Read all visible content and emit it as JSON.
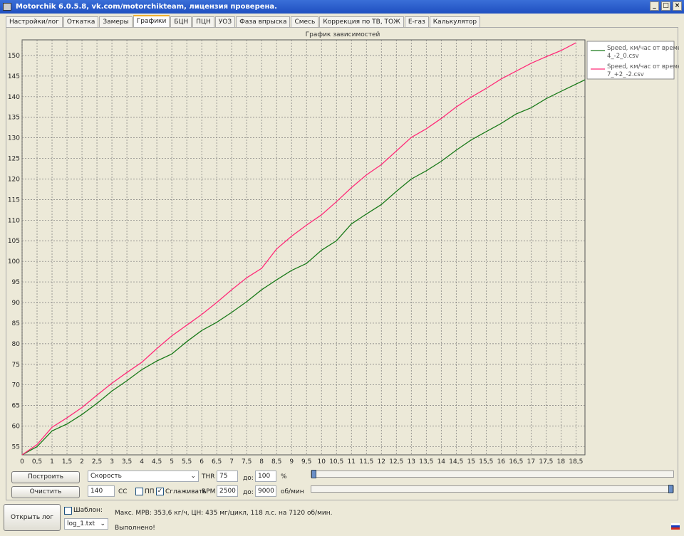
{
  "window": {
    "title": "Motorchik 6.0.5.8, vk.com/motorchikteam, лицензия проверена.",
    "buttons": [
      "_",
      "□",
      "×"
    ]
  },
  "tabs": [
    {
      "label": "Настройки/лог"
    },
    {
      "label": "Откатка"
    },
    {
      "label": "Замеры"
    },
    {
      "label": "Графики",
      "active": true
    },
    {
      "label": "БЦН"
    },
    {
      "label": "ПЦН"
    },
    {
      "label": "УОЗ"
    },
    {
      "label": "Фаза впрыска"
    },
    {
      "label": "Смесь"
    },
    {
      "label": "Коррекция по ТВ, ТОЖ"
    },
    {
      "label": "Е-газ"
    },
    {
      "label": "Калькулятор"
    }
  ],
  "controls": {
    "build": "Построить",
    "clear": "Очистить",
    "param": "Скорость",
    "cc_value": "140",
    "cc_label": "CC",
    "pp_label": "ПП",
    "smooth_label": "Сглаживать",
    "thr_label": "THR",
    "thr_from": "75",
    "to1": "до:",
    "thr_to": "100",
    "pct": "%",
    "rpm_label": "RPM",
    "rpm_from": "2500",
    "to2": "до:",
    "rpm_to": "9000",
    "rpm_unit": "об/мин",
    "slider1": 0.0,
    "slider2": 1.0
  },
  "bottom": {
    "open_log": "Открыть лог",
    "template_label": "Шаблон:",
    "log_file": "log_1.txt",
    "stats": "Макс. МРВ: 353,6 кг/ч, ЦН: 435 мг/цикл, 118 л.с. на 7120 об/мин.",
    "status": "Выполнено!"
  },
  "chart_data": {
    "type": "line",
    "title": "График зависимостей",
    "xlim": [
      0,
      18.8
    ],
    "ylim": [
      53,
      153.8
    ],
    "grid": true,
    "legend": "top-right",
    "xticks": [
      0,
      0.5,
      1,
      1.5,
      2,
      2.5,
      3,
      3.5,
      4,
      4.5,
      5,
      5.5,
      6,
      6.5,
      7,
      7.5,
      8,
      8.5,
      9,
      9.5,
      10,
      10.5,
      11,
      11.5,
      12,
      12.5,
      13,
      13.5,
      14,
      14.5,
      15,
      15.5,
      16,
      16.5,
      17,
      17.5,
      18,
      18.5
    ],
    "yticks": [
      55,
      60,
      65,
      70,
      75,
      80,
      85,
      90,
      95,
      100,
      105,
      110,
      115,
      120,
      125,
      130,
      135,
      140,
      145,
      150
    ],
    "series": [
      {
        "name": "Speed, км/час от времени",
        "file": "4_-2_0.csv",
        "color": "#1a7a1a",
        "x": [
          0,
          0.5,
          1,
          1.5,
          2,
          2.5,
          3,
          3.5,
          4,
          4.5,
          5,
          5.5,
          6,
          6.5,
          7,
          7.5,
          8,
          8.5,
          9,
          9.5,
          10,
          10.5,
          11,
          11.5,
          12,
          12.5,
          13,
          13.5,
          14,
          14.5,
          15,
          15.5,
          16,
          16.5,
          17,
          17.5,
          18,
          18.8
        ],
        "y": [
          53,
          55,
          58.8,
          60.5,
          62.8,
          65.5,
          68.5,
          71,
          73.7,
          75.8,
          77.5,
          80.5,
          83.2,
          85.2,
          87.6,
          90.2,
          93.1,
          95.5,
          97.8,
          99.5,
          102.7,
          105,
          109.1,
          111.5,
          113.8,
          117,
          120,
          122,
          124.3,
          127,
          129.5,
          131.5,
          133.5,
          135.8,
          137.3,
          139.5,
          141.3,
          144.1
        ]
      },
      {
        "name": "Speed, км/час от времени",
        "file": "7_+2_-2.csv",
        "color": "#ff2a78",
        "x": [
          0,
          0.5,
          1,
          1.5,
          2,
          2.5,
          3,
          3.5,
          4,
          4.5,
          5,
          5.5,
          6,
          6.5,
          7,
          7.5,
          8,
          8.5,
          9,
          9.5,
          10,
          10.5,
          11,
          11.5,
          12,
          12.5,
          13,
          13.5,
          14,
          14.5,
          15,
          15.5,
          16,
          16.5,
          17,
          17.5,
          18,
          18.5
        ],
        "y": [
          53,
          55.5,
          59.7,
          62,
          64.5,
          67.5,
          70.4,
          73,
          75.5,
          78.8,
          81.9,
          84.5,
          87.1,
          90,
          93.1,
          96,
          98.3,
          103,
          106.1,
          108.8,
          111.3,
          114.5,
          117.9,
          121,
          123.5,
          126.8,
          130.1,
          132.2,
          134.7,
          137.5,
          139.9,
          142,
          144.3,
          146.2,
          148.1,
          149.7,
          151.2,
          153.1
        ]
      }
    ]
  }
}
